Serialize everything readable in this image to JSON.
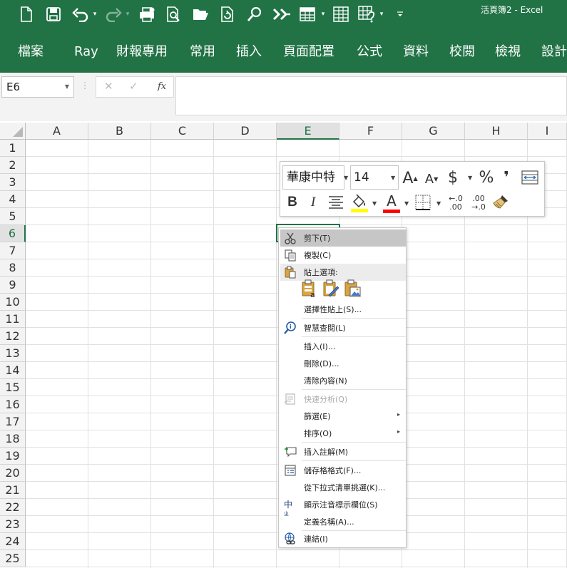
{
  "window": {
    "title": "活頁簿2 - Excel"
  },
  "qat": {
    "icons": [
      "new-file-icon",
      "save-icon",
      "undo-icon",
      "redo-icon",
      "quick-print-icon",
      "print-preview-icon",
      "open-folder-icon",
      "refresh-icon",
      "find-icon",
      "repeat-icon",
      "table-icon",
      "form-icon",
      "more-icon",
      "customize-qat-icon"
    ]
  },
  "ribbon": {
    "tabs": [
      "檔案",
      "Ray",
      "財報專用",
      "常用",
      "插入",
      "頁面配置",
      "公式",
      "資料",
      "校閱",
      "檢視",
      "設計"
    ]
  },
  "formula_bar": {
    "name_box": "E6",
    "fx_label": "fx",
    "cancel_glyph": "✕",
    "enter_glyph": "✓",
    "formula": ""
  },
  "sheet": {
    "columns": [
      "A",
      "B",
      "C",
      "D",
      "E",
      "F",
      "G",
      "H",
      "I"
    ],
    "rows": [
      "1",
      "2",
      "3",
      "4",
      "5",
      "6",
      "7",
      "8",
      "9",
      "10",
      "11",
      "12",
      "13",
      "14",
      "15",
      "16",
      "17",
      "18",
      "19",
      "20",
      "21",
      "22",
      "23",
      "24",
      "25"
    ],
    "selected_column": "E",
    "selected_row": "6",
    "active_cell": "E6"
  },
  "mini_toolbar": {
    "font_name": "華康中特",
    "font_size": "14",
    "grow_font": "A",
    "shrink_font": "A",
    "currency": "$",
    "percent": "%",
    "comma": "❜",
    "bold": "B",
    "italic": "I",
    "font_color_letter": "A",
    "increase_decimal_top": "←.0",
    "increase_decimal_bottom": ".00",
    "decrease_decimal_top": ".00",
    "decrease_decimal_bottom": "→.0",
    "fill_color": "#ffff00",
    "font_color": "#ff0000"
  },
  "context_menu": {
    "cut": "剪下(T)",
    "copy": "複製(C)",
    "paste_options": "貼上選項:",
    "paste_special": "選擇性貼上(S)...",
    "smart_lookup": "智慧查閱(L)",
    "insert": "插入(I)...",
    "delete": "刪除(D)...",
    "clear_contents": "清除內容(N)",
    "quick_analysis": "快速分析(Q)",
    "filter": "篩選(E)",
    "sort": "排序(O)",
    "insert_comment": "插入註解(M)",
    "format_cells": "儲存格格式(F)...",
    "pick_from_list": "從下拉式清單挑選(K)...",
    "phonetic": "顯示注音標示欄位(S)",
    "define_name": "定義名稱(A)...",
    "link": "連結(I)",
    "phonetic_icon_text": "中",
    "submenu_arrow": "▸"
  },
  "colors": {
    "accent": "#217346",
    "header_bg": "#f3f3f3",
    "gridline": "#e1e1e1",
    "menu_highlight": "#c6c6c6"
  }
}
